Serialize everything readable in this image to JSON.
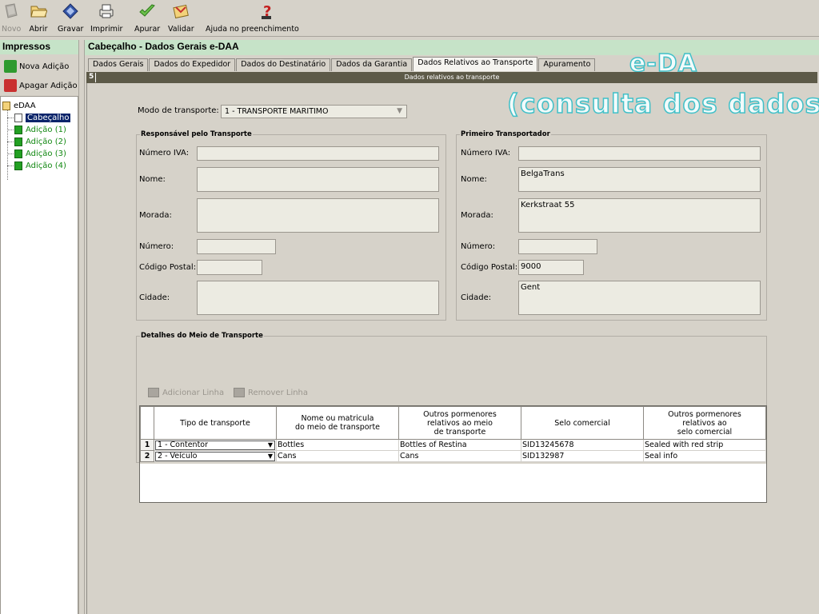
{
  "toolbar": {
    "novo": "Novo",
    "abrir": "Abrir",
    "gravar": "Gravar",
    "imprimir": "Imprimir",
    "apurar": "Apurar",
    "validar": "Validar",
    "ajuda": "Ajuda no preenchimento"
  },
  "left_panel": {
    "header": "Impressos",
    "nova_adicao": "Nova Adição",
    "apagar_adicao": "Apagar Adição",
    "tree": {
      "root": "eDAA",
      "items": [
        "Cabeçalho",
        "Adição (1)",
        "Adição (2)",
        "Adição (3)",
        "Adição (4)"
      ]
    }
  },
  "main": {
    "title": "Cabeçalho - Dados Gerais e-DAA",
    "tabs": [
      "Dados Gerais",
      "Dados do Expedidor",
      "Dados do Destinatário",
      "Dados da Garantia",
      "Dados Relativos ao Transporte",
      "Apuramento"
    ],
    "active_tab": "Dados Relativos ao Transporte",
    "watermark_1": "e-DA",
    "watermark_2": "(consulta dos dados)",
    "panel_number": "5",
    "panel_title": "Dados relativos ao transporte"
  },
  "transport_mode": {
    "label": "Modo de transporte:",
    "value": "1 - TRANSPORTE MARITIMO"
  },
  "responsavel": {
    "legend": "Responsável pelo Transporte",
    "nif_label": "Número IVA:",
    "nome_label": "Nome:",
    "morada_label": "Morada:",
    "numero_label": "Número:",
    "cp_label": "Código Postal:",
    "cidade_label": "Cidade:",
    "nif": "",
    "nome": "",
    "morada": "",
    "numero": "",
    "cp": "",
    "cidade": ""
  },
  "primeiro": {
    "legend": "Primeiro Transportador",
    "nif_label": "Número IVA:",
    "nome_label": "Nome:",
    "morada_label": "Morada:",
    "numero_label": "Número:",
    "cp_label": "Código Postal:",
    "cidade_label": "Cidade:",
    "nif": "",
    "nome": "BelgaTrans",
    "morada": "Kerkstraat 55",
    "numero": "",
    "cp": "9000",
    "cidade": "Gent"
  },
  "detalhes": {
    "legend": "Detalhes do Meio de Transporte",
    "add_line": "Adicionar Linha",
    "remove_line": "Remover Linha",
    "columns": [
      "Tipo de transporte",
      "Nome ou matricula\ndo meio de transporte",
      "Outros pormenores\nrelativos ao meio\nde transporte",
      "Selo comercial",
      "Outros pormenores\nrelativos ao\nselo comercial"
    ],
    "rows": [
      {
        "n": "1",
        "tipo": "1 - Contentor",
        "nome": "Bottles",
        "outros": "Bottles of Restina",
        "selo": "SID13245678",
        "outros_selo": "Sealed with red strip"
      },
      {
        "n": "2",
        "tipo": "2 - Veículo",
        "nome": "Cans",
        "outros": "Cans",
        "selo": "SID132987",
        "outros_selo": "Seal info"
      }
    ]
  }
}
